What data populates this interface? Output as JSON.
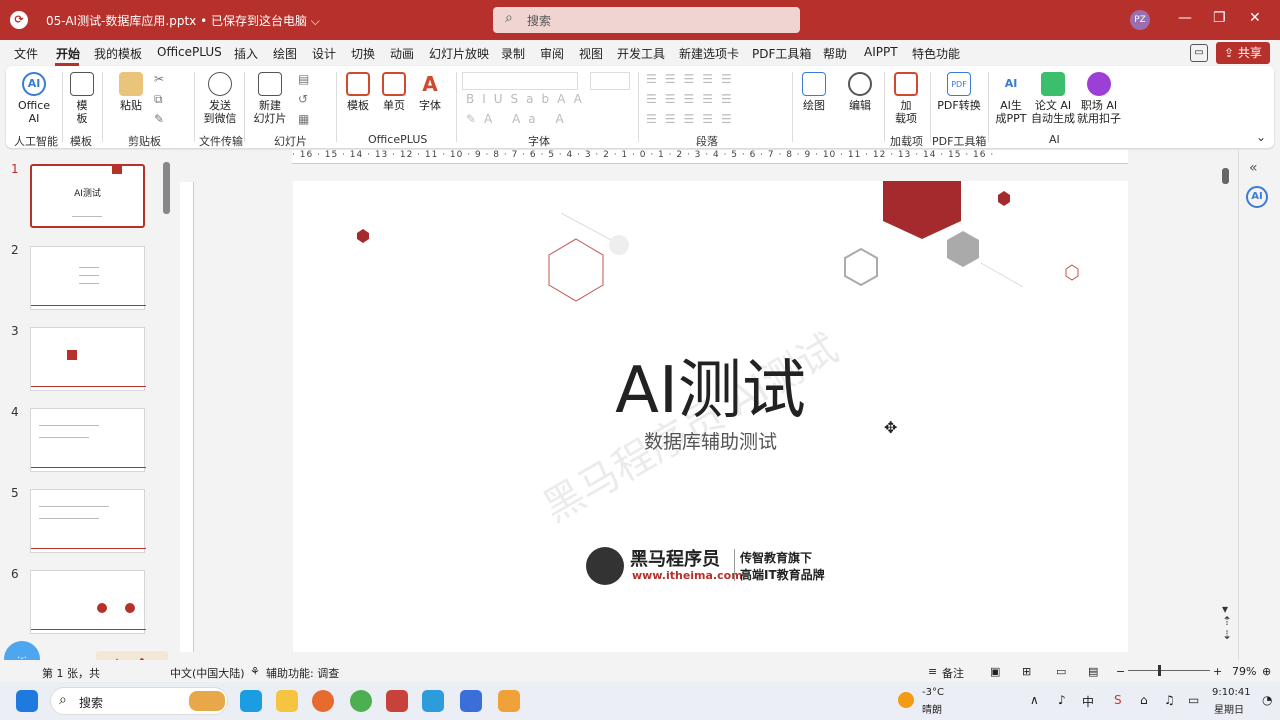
{
  "titlebar": {
    "doc_title": "05-AI测试-数据库应用.pptx • 已保存到这台电脑 ⌵",
    "search_placeholder": "搜索",
    "avatar": "PZ",
    "minimize": "—",
    "restore": "❐",
    "close": "✕"
  },
  "menu": {
    "items": [
      "文件",
      "开始",
      "我的模板",
      "OfficePLUS",
      "插入",
      "绘图",
      "设计",
      "切换",
      "动画",
      "幻灯片放映",
      "录制",
      "审阅",
      "视图",
      "开发工具",
      "新建选项卡",
      "PDF工具箱",
      "帮助",
      "AIPPT",
      "特色功能"
    ],
    "share": "共享"
  },
  "ribbon": {
    "buttons": {
      "office_ai": "Office\nAI",
      "template": "模\n板",
      "paste": "粘贴",
      "send_wechat": "发送\n到微信",
      "new_slide": "新建\n幻灯片",
      "tpl2": "模板",
      "single_page": "单页",
      "font": "字体",
      "draw": "绘图",
      "edit": "编辑",
      "addin": "加\n载项",
      "pdf_convert": "PDF转换",
      "ai_ppt": "AI生\n成PPT",
      "essay_ai": "论文 AI\n自动生成",
      "workplace_ai": "职场 AI\n就用扣子"
    },
    "groups": [
      "人工智能",
      "模板",
      "剪贴板",
      "文件传输",
      "幻灯片",
      "OfficePLUS",
      "字体",
      "段落",
      "加载项",
      "PDF工具箱",
      "AI"
    ]
  },
  "ruler": {
    "h_ticks": "· 16 · 15 · 14 · 13 · 12 · 11 · 10 · 9 · 8 · 7 · 6 · 5 · 4 · 3 · 2 · 1 · 0 · 1 · 2 · 3 · 4 · 5 · 6 · 7 · 8 · 9 · 10 · 11 · 12 · 13 · 14 · 15 · 16 ·"
  },
  "thumbnails": [
    {
      "num": "1",
      "label": "AI测试"
    },
    {
      "num": "2",
      "label": ""
    },
    {
      "num": "3",
      "label": ""
    },
    {
      "num": "4",
      "label": ""
    },
    {
      "num": "5",
      "label": ""
    },
    {
      "num": "6",
      "label": ""
    }
  ],
  "slide": {
    "title": "AI测试",
    "subtitle": "数据库辅助测试",
    "watermark": "黑马程序员 AI测试",
    "logo_name": "黑马程序员",
    "logo_url": "www.itheima.com",
    "logo_tag1": "传智教育旗下",
    "logo_tag2": "高端IT教育品牌"
  },
  "status": {
    "slide_info": "第 1 张，共",
    "language": "中文(中国大陆)",
    "accessibility": "辅助功能: 调查",
    "notes": "备注",
    "zoom": "79%"
  },
  "ime": {
    "text": "中"
  },
  "taskbar": {
    "search": "搜索",
    "weather_temp": "-3°C",
    "weather_desc": "晴朗",
    "time": "9:10:41",
    "day": "星期日"
  },
  "colors": {
    "accent": "#b7312c"
  }
}
